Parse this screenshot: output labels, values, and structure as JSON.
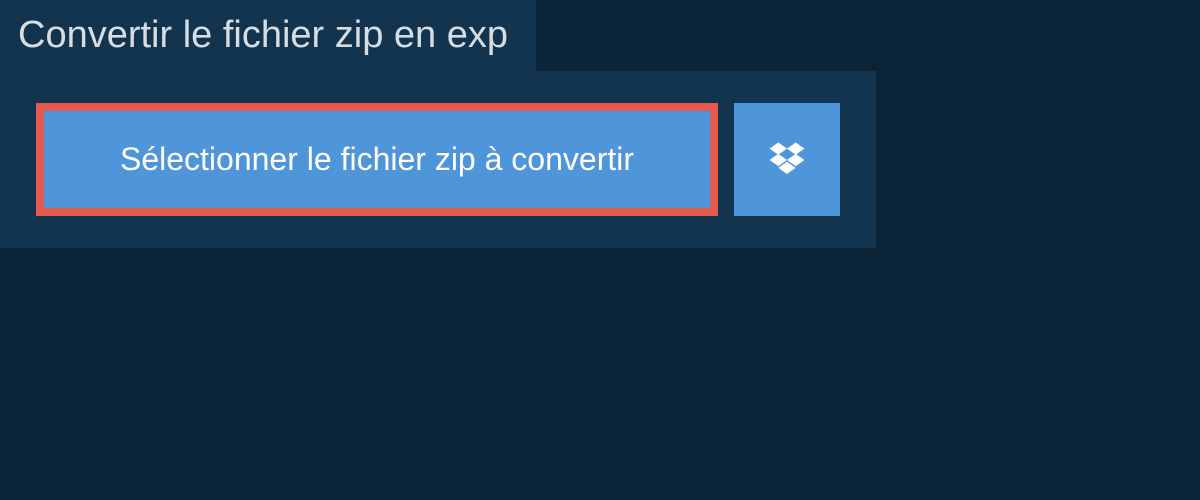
{
  "title": "Convertir le fichier zip en exp",
  "select_button_label": "Sélectionner le fichier zip à convertir",
  "colors": {
    "background_outer": "#0c2437",
    "background_panel": "#12344f",
    "button_primary": "#4f95d9",
    "button_highlight_border": "#e55a4f",
    "text_light": "#d8dde1",
    "text_white": "#ffffff"
  },
  "icons": {
    "dropbox": "dropbox-icon"
  }
}
